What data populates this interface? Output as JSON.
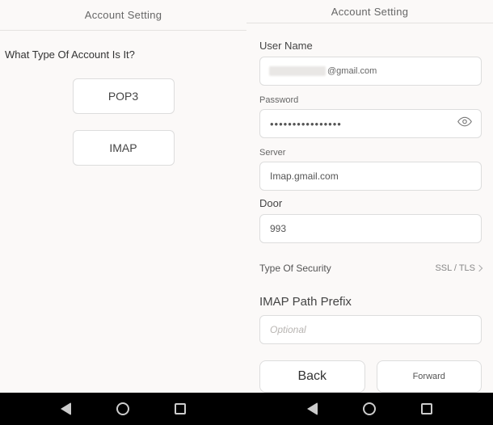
{
  "left": {
    "title": "Account Setting",
    "question": "What Type Of Account Is It?",
    "options": {
      "pop3": "POP3",
      "imap": "IMAP"
    }
  },
  "right": {
    "title": "Account Setting",
    "labels": {
      "username": "User Name",
      "password": "Password",
      "server": "Server",
      "door": "Door",
      "security": "Type Of Security",
      "imap_prefix": "IMAP Path Prefix"
    },
    "values": {
      "username_suffix": "@gmail.com",
      "password": "••••••••••••••••",
      "server": "Imap.gmail.com",
      "door": "993",
      "security_value": "SSL / TLS",
      "imap_prefix_placeholder": "Optional"
    },
    "buttons": {
      "back": "Back",
      "forward": "Forward"
    }
  }
}
